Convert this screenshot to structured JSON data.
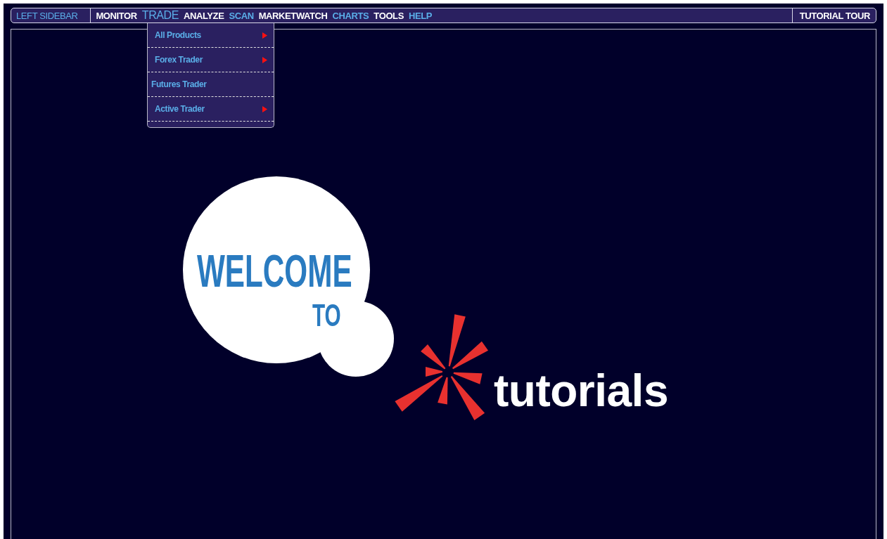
{
  "left_button": "LEFT SIDEBAR",
  "nav": [
    {
      "label": "MONITOR",
      "highlighted": false,
      "selected": false
    },
    {
      "label": "TRADE",
      "highlighted": true,
      "selected": true
    },
    {
      "label": "ANALYZE",
      "highlighted": false,
      "selected": false
    },
    {
      "label": "SCAN",
      "highlighted": true,
      "selected": false
    },
    {
      "label": "MARKETWATCH",
      "highlighted": false,
      "selected": false
    },
    {
      "label": "CHARTS",
      "highlighted": true,
      "selected": false
    },
    {
      "label": "TOOLS",
      "highlighted": false,
      "selected": false
    },
    {
      "label": "HELP",
      "highlighted": true,
      "selected": false
    }
  ],
  "right_button": "TUTORIAL TOUR",
  "dropdown": [
    {
      "label": "All Products",
      "has_submenu": true
    },
    {
      "label": "Forex Trader",
      "has_submenu": true
    },
    {
      "label": "Futures Trader",
      "has_submenu": false
    },
    {
      "label": "Active Trader",
      "has_submenu": true
    }
  ],
  "welcome": {
    "line_1": "WELCOME",
    "line_2": "TO",
    "brand": "tutorials"
  }
}
